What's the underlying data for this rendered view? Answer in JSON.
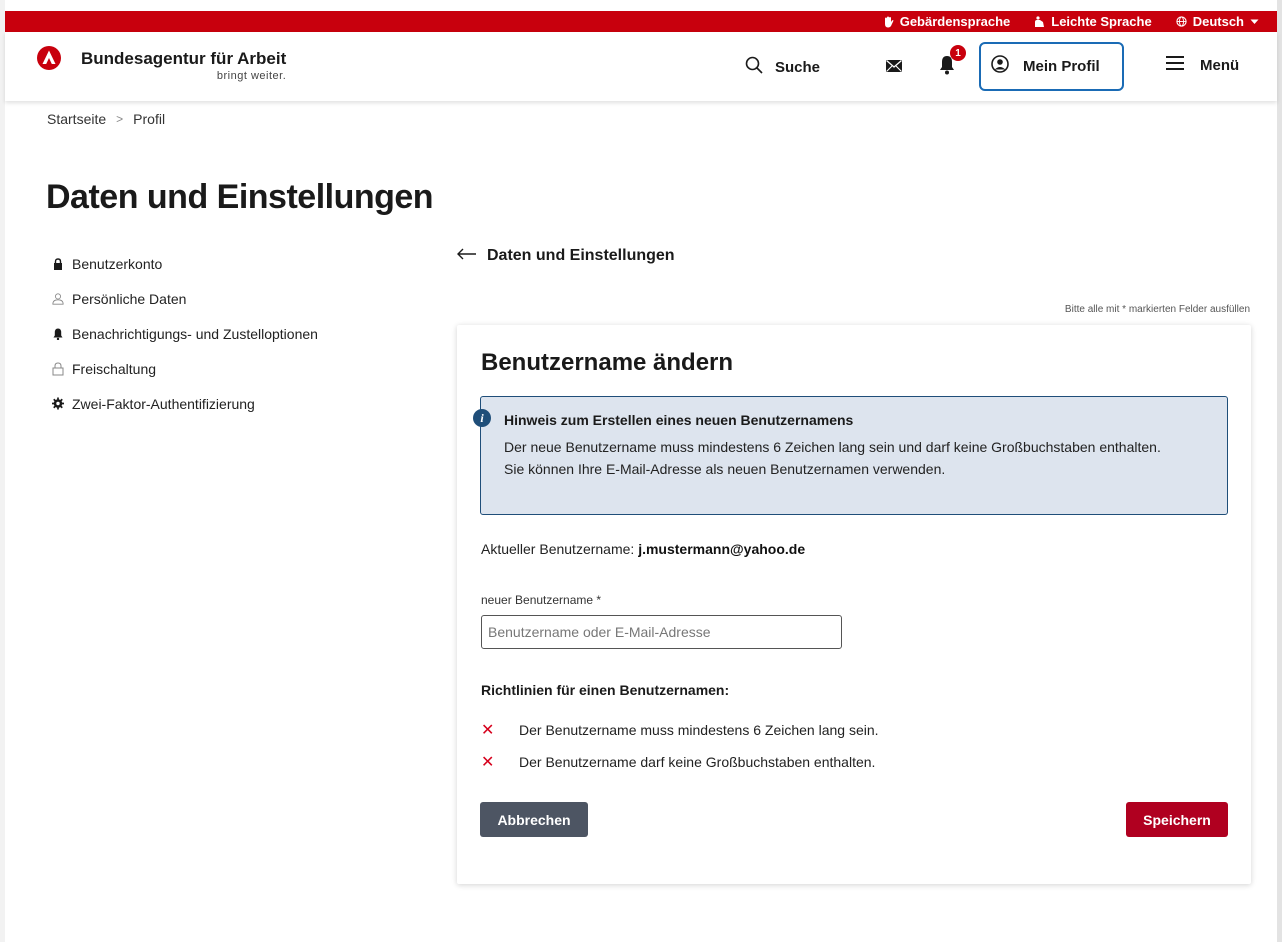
{
  "topbar": {
    "sign_language": "Gebärdensprache",
    "easy_language": "Leichte Sprache",
    "language": "Deutsch"
  },
  "header": {
    "brand_name": "Bundesagentur für Arbeit",
    "brand_slogan": "bringt weiter.",
    "search_label": "Suche",
    "notification_count": "1",
    "profile_label": "Mein Profil",
    "menu_label": "Menü"
  },
  "breadcrumb": {
    "home": "Startseite",
    "separator": ">",
    "current": "Profil"
  },
  "page_title": "Daten und Einstellungen",
  "sidebar": {
    "items": [
      {
        "label": "Benutzerkonto",
        "icon": "lock-icon"
      },
      {
        "label": "Persönliche Daten",
        "icon": "person-icon"
      },
      {
        "label": "Benachrichtigungs- und Zustelloptionen",
        "icon": "bell-icon"
      },
      {
        "label": "Freischaltung",
        "icon": "unlock-icon"
      },
      {
        "label": "Zwei-Faktor-Authentifizierung",
        "icon": "gear-icon"
      }
    ]
  },
  "main": {
    "back_label": "Daten und Einstellungen",
    "required_note": "Bitte alle mit * markierten Felder ausfüllen",
    "card_title": "Benutzername ändern",
    "hint": {
      "title": "Hinweis zum Erstellen eines neuen Benutzernamens",
      "line1": "Der neue Benutzername muss mindestens 6 Zeichen lang sein und darf keine Großbuchstaben enthalten.",
      "line2": "Sie können Ihre E-Mail-Adresse als neuen Benutzernamen verwenden."
    },
    "current_user_label": "Aktueller Benutzername:",
    "current_user_value": "j.mustermann@yahoo.de",
    "new_user_label": "neuer Benutzername *",
    "new_user_placeholder": "Benutzername oder E-Mail-Adresse",
    "new_user_value": "",
    "rules_title": "Richtlinien für einen Benutzernamen:",
    "rules": [
      "Der Benutzername muss mindestens 6 Zeichen lang sein.",
      "Der Benutzername darf keine Großbuchstaben enthalten."
    ],
    "cancel_label": "Abbrechen",
    "save_label": "Speichern"
  },
  "colors": {
    "brand_red": "#c8000d",
    "save_red": "#b00020",
    "cancel_gray": "#4d5563",
    "hint_bg": "#dde4ee",
    "hint_border": "#1f4e79",
    "focus_blue": "#1a6bb5"
  }
}
